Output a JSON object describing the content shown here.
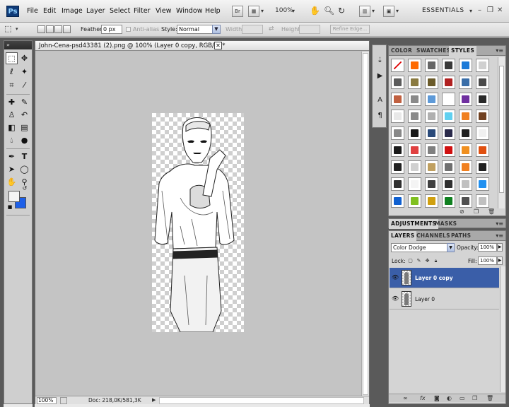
{
  "app": {
    "logo": "Ps"
  },
  "menu": [
    "File",
    "Edit",
    "Image",
    "Layer",
    "Select",
    "Filter",
    "View",
    "Window",
    "Help"
  ],
  "menubar": {
    "br_label": "Br",
    "zoom": "100%",
    "workspace": "ESSENTIALS"
  },
  "options": {
    "feather_label": "Feather:",
    "feather_value": "0 px",
    "antialias_label": "Anti-alias",
    "style_label": "Style:",
    "style_value": "Normal",
    "width_label": "Width:",
    "height_label": "Height:",
    "refine_edge": "Refine Edge..."
  },
  "document": {
    "title": "John-Cena-psd43381 (2).png @ 100% (Layer 0 copy, RGB/8) *",
    "status_zoom": "100%",
    "status_doc": "Doc: 218,0K/581,3K"
  },
  "styles_panel": {
    "tabs": [
      "COLOR",
      "SWATCHES",
      "STYLES"
    ],
    "active_tab": "STYLES"
  },
  "adjustments_panel": {
    "tabs": [
      "ADJUSTMENTS",
      "MASKS"
    ]
  },
  "layers_panel": {
    "tabs": [
      "LAYERS",
      "CHANNELS",
      "PATHS"
    ],
    "blend_mode": "Color Dodge",
    "opacity_label": "Opacity:",
    "opacity": "100%",
    "lock_label": "Lock:",
    "fill_label": "Fill:",
    "fill": "100%",
    "layers": [
      {
        "name": "Layer 0 copy",
        "selected": true
      },
      {
        "name": "Layer 0",
        "selected": false
      }
    ]
  },
  "colors": {
    "foreground": "#f4f4f4",
    "background": "#1e60e8",
    "selection_blue": "#3a5ea8"
  },
  "style_swatches": [
    "#ffffff",
    "#ff6a00",
    "#666666",
    "#3a3a3a",
    "#1b7ad8",
    "#d0d0d0",
    "#5c5c5c",
    "#8a7a40",
    "#6b5b2a",
    "#b02020",
    "#3a6ea8",
    "#4a4a4a",
    "#c06040",
    "#8a8a8a",
    "#5e9ad8",
    "#ffffff",
    "#7030a0",
    "#2a2a2a",
    "#e8e8e8",
    "#8a8a8a",
    "#b0b0b0",
    "#60d0f0",
    "#f08020",
    "#704020",
    "#888888",
    "#1a1a1a",
    "#2a4a7a",
    "#2a2a4a",
    "#222222",
    "#f0f0f0",
    "#1a1a1a",
    "#e04040",
    "#808080",
    "#d01010",
    "#f09020",
    "#e05010",
    "#222222",
    "#d0d0d0",
    "#c0a060",
    "#707070",
    "#f08020",
    "#202020",
    "#303030",
    "#f4f4f4",
    "#404040",
    "#303030",
    "#c0c0c0",
    "#2090f0",
    "#1060d0",
    "#80c020",
    "#d0a010",
    "#108020",
    "#505050",
    "#c0c0c0"
  ]
}
